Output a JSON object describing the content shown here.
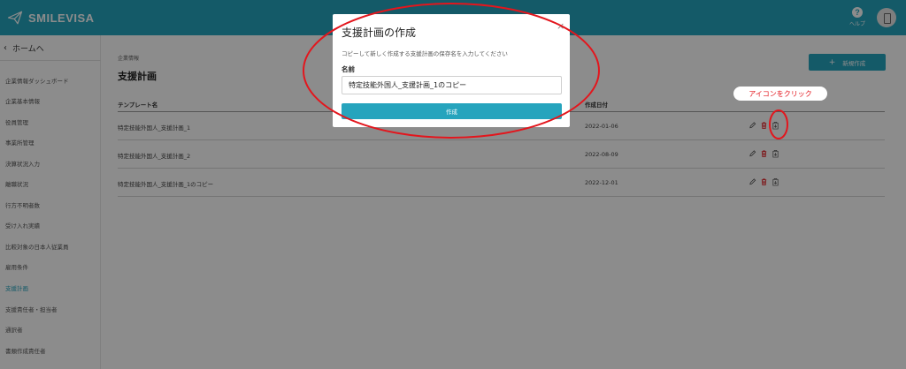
{
  "header": {
    "brand": "SMILEVISA",
    "help_label": "ヘルプ"
  },
  "sidebar": {
    "back_label": "ホームへ",
    "items": [
      {
        "label": "企業情報ダッシュボード"
      },
      {
        "label": "企業基本情報"
      },
      {
        "label": "役員管理"
      },
      {
        "label": "事業所管理"
      },
      {
        "label": "決算状況入力"
      },
      {
        "label": "離職状況"
      },
      {
        "label": "行方不明者数"
      },
      {
        "label": "受け入れ実績"
      },
      {
        "label": "比較対象の日本人従業員"
      },
      {
        "label": "雇用条件"
      },
      {
        "label": "支援計画",
        "active": true
      },
      {
        "label": "支援責任者・担当者"
      },
      {
        "label": "通訳者"
      },
      {
        "label": "書類作成責任者"
      }
    ]
  },
  "main": {
    "breadcrumb": "企業情報",
    "title": "支援計画",
    "new_button_label": "新規作成",
    "columns": {
      "template_name": "テンプレート名",
      "created_date": "作成日付"
    },
    "rows": [
      {
        "name": "特定技能外国人_支援計画_1",
        "date": "2022-01-06"
      },
      {
        "name": "特定技能外国人_支援計画_2",
        "date": "2022-08-09"
      },
      {
        "name": "特定技能外国人_支援計画_1のコピー",
        "date": "2022-12-01"
      }
    ]
  },
  "modal": {
    "title": "支援計画の作成",
    "description": "コピーして新しく作成する支援計画の保存名を入力してください",
    "field_label": "名前",
    "field_value": "特定技能外国人_支援計画_1のコピー",
    "create_button_label": "作成"
  },
  "annotation": {
    "callout_text": "アイコンをクリック",
    "color": "#e3161d"
  },
  "colors": {
    "accent": "#26a4bd",
    "delete": "#e3161d"
  }
}
